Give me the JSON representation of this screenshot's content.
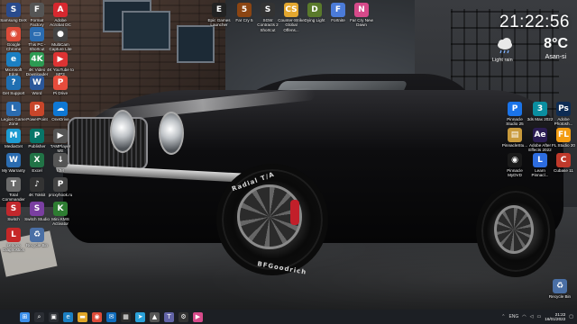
{
  "desktop_left": [
    {
      "label": "Samsung DeX",
      "color": "#2a4b8d",
      "glyph": "S"
    },
    {
      "label": "Format Factory",
      "color": "#555",
      "glyph": "F"
    },
    {
      "label": "Adobe Acrobat DC",
      "color": "#d7282f",
      "glyph": "A"
    },
    {
      "label": "Google Chrome",
      "color": "#dd4b39",
      "glyph": "◉"
    },
    {
      "label": "This PC - Shortcut",
      "color": "#2b6cb0",
      "glyph": "▭"
    },
    {
      "label": "MultiCam Capture Lite",
      "color": "#444",
      "glyph": "●"
    },
    {
      "label": "Microsoft Edge",
      "color": "#1b7fc2",
      "glyph": "e"
    },
    {
      "label": "4K Video Downloader",
      "color": "#2c9a52",
      "glyph": "4K"
    },
    {
      "label": "4K YouTube to MP3",
      "color": "#d33",
      "glyph": "▶"
    },
    {
      "label": "Get Support",
      "color": "#1f6fb2",
      "glyph": "?"
    },
    {
      "label": "Word",
      "color": "#2b579a",
      "glyph": "W"
    },
    {
      "label": "Pi Drive",
      "color": "#e74c3c",
      "glyph": "P"
    },
    {
      "label": "Legion Game Zone",
      "color": "#2b6cb0",
      "glyph": "L"
    },
    {
      "label": "PowerPoint",
      "color": "#c8462a",
      "glyph": "P"
    },
    {
      "label": "OneDrive",
      "color": "#0f78d4",
      "glyph": "☁"
    },
    {
      "label": "MediaGet",
      "color": "#1d9bd1",
      "glyph": "M"
    },
    {
      "label": "Publisher",
      "color": "#077568",
      "glyph": "P"
    },
    {
      "label": "TAMPlayer ME",
      "color": "#555",
      "glyph": "▶"
    },
    {
      "label": "My Warranty",
      "color": "#2b6cb0",
      "glyph": "W"
    },
    {
      "label": "Excel",
      "color": "#217346",
      "glyph": "X"
    },
    {
      "label": "IdM",
      "color": "#555",
      "glyph": "↓"
    },
    {
      "label": "Total Commander 64 bit",
      "color": "#6b6b6b",
      "glyph": "T"
    },
    {
      "label": "4K Tokkit",
      "color": "#333",
      "glyph": "♪"
    },
    {
      "label": "proxyhook.ru",
      "color": "#444",
      "glyph": "P"
    },
    {
      "label": "Switch",
      "color": "#c1282d",
      "glyph": "S"
    },
    {
      "label": "Switch Studio",
      "color": "#7a3fa1",
      "glyph": "S"
    },
    {
      "label": "Mini KMS Activator",
      "color": "#2e7d32",
      "glyph": "K"
    },
    {
      "label": "Lenovo Diagnostics",
      "color": "#c62828",
      "glyph": "L"
    },
    {
      "label": "Recycle Bin",
      "color": "#4a6fa5",
      "glyph": "♻"
    }
  ],
  "desktop_top": [
    {
      "label": "Epic Games Launcher",
      "color": "#222",
      "glyph": "E"
    },
    {
      "label": "Far Cry 5",
      "color": "#8b4513",
      "glyph": "5"
    },
    {
      "label": "SGW Contracts 2 Shortcut",
      "color": "#333",
      "glyph": "S"
    },
    {
      "label": "Counter-Strike Global Offens...",
      "color": "#e3a72f",
      "glyph": "CS"
    },
    {
      "label": "Dying Light",
      "color": "#5a7a2b",
      "glyph": "D"
    },
    {
      "label": "Fortnite",
      "color": "#4b7bd8",
      "glyph": "F"
    },
    {
      "label": "Far Cry New Dawn",
      "color": "#d64a8a",
      "glyph": "N"
    }
  ],
  "desktop_right": [
    {
      "label": "Pinnacle Studio 25",
      "color": "#1a73e8",
      "glyph": "P"
    },
    {
      "label": "3ds Max 2022",
      "color": "#0a8ea0",
      "glyph": "3"
    },
    {
      "label": "Adobe Photosh...",
      "color": "#0d2c54",
      "glyph": "Ps"
    },
    {
      "label": "PinnacleStu...",
      "color": "#c99a3c",
      "glyph": "▤"
    },
    {
      "label": "Adobe After Effects 2022",
      "color": "#2b1d53",
      "glyph": "Ae"
    },
    {
      "label": "FL Studio 20",
      "color": "#f39c12",
      "glyph": "FL"
    },
    {
      "label": "Pinnacle MyDVD",
      "color": "#1a1a1a",
      "glyph": "◉"
    },
    {
      "label": "Learn Pinnacl...",
      "color": "#2d6cdf",
      "glyph": "L"
    },
    {
      "label": "Cubase 11",
      "color": "#c0392b",
      "glyph": "C"
    },
    {
      "label": "Recycle Bin",
      "color": "#4a6fa5",
      "glyph": "♻"
    }
  ],
  "widget": {
    "time": "21:22:56",
    "weather": "Light rain",
    "temp": "8°C",
    "location": "Asan-si"
  },
  "tire": {
    "text1": "Radial T/A",
    "text2": "BFGoodrich"
  },
  "taskbar": {
    "apps": [
      {
        "name": "start",
        "color": "#3b8ee8",
        "glyph": "⊞"
      },
      {
        "name": "search",
        "color": "#2a2d33",
        "glyph": "⌕"
      },
      {
        "name": "task-view",
        "color": "#2a2d33",
        "glyph": "▣"
      },
      {
        "name": "edge",
        "color": "#1b7fc2",
        "glyph": "e"
      },
      {
        "name": "explorer",
        "color": "#e0a527",
        "glyph": "▬"
      },
      {
        "name": "chrome",
        "color": "#dd4b39",
        "glyph": "◉"
      },
      {
        "name": "mail",
        "color": "#0f6cbd",
        "glyph": "✉"
      },
      {
        "name": "store",
        "color": "#2c2c2c",
        "glyph": "▦"
      },
      {
        "name": "telegram",
        "color": "#2aa1da",
        "glyph": "➤"
      },
      {
        "name": "photos",
        "color": "#555",
        "glyph": "▲"
      },
      {
        "name": "teams",
        "color": "#6264a7",
        "glyph": "T"
      },
      {
        "name": "settings",
        "color": "#333",
        "glyph": "⚙"
      },
      {
        "name": "media",
        "color": "#d64a8a",
        "glyph": "▶"
      }
    ],
    "lang": "ENG",
    "time": "21:22",
    "date": "16/01/2022"
  }
}
